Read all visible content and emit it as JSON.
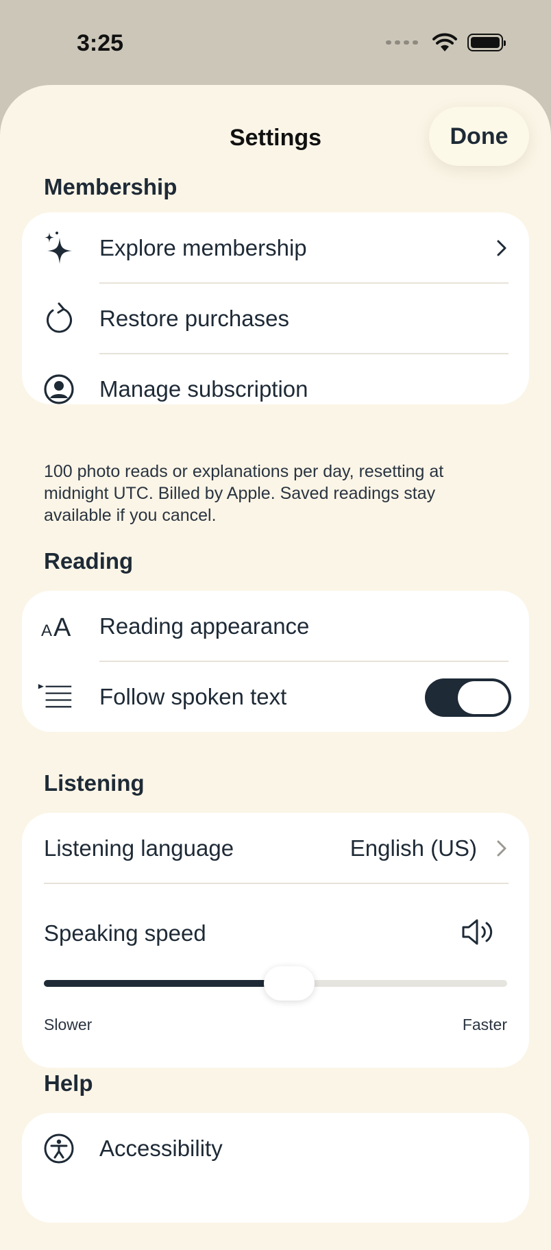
{
  "status_bar": {
    "time": "3:25"
  },
  "header": {
    "title": "Settings",
    "done_label": "Done"
  },
  "membership": {
    "section_title": "Membership",
    "items": [
      {
        "label": "Explore membership",
        "icon": "sparkles-icon"
      },
      {
        "label": "Restore purchases",
        "icon": "restore-icon"
      },
      {
        "label": "Manage subscription",
        "icon": "account-circle-icon"
      }
    ],
    "footnote": "100 photo reads or explanations per day, resetting at midnight UTC. Billed by Apple. Saved readings stay available if you cancel."
  },
  "reading": {
    "section_title": "Reading",
    "items": [
      {
        "label": "Reading appearance",
        "icon": "text-size-icon"
      },
      {
        "label": "Follow spoken text",
        "icon": "follow-text-icon",
        "toggle_on": true
      }
    ]
  },
  "listening": {
    "section_title": "Listening",
    "language_label": "Listening language",
    "language_value": "English (US)",
    "speed_label": "Speaking speed",
    "speed_fraction": 0.53,
    "slower_label": "Slower",
    "faster_label": "Faster"
  },
  "help": {
    "section_title": "Help",
    "items": [
      {
        "label": "Accessibility",
        "icon": "accessibility-icon"
      }
    ]
  },
  "colors": {
    "accent": "#1e2a36",
    "sheet_bg": "#fbf5e7",
    "card_bg": "#ffffff"
  }
}
